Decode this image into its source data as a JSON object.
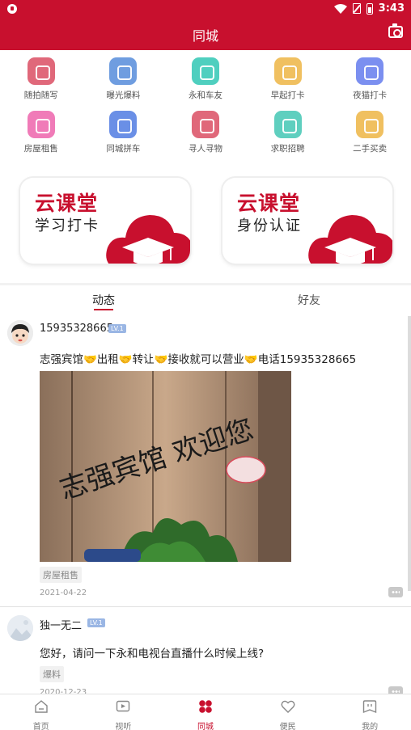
{
  "status_bar": {
    "time": "3:43"
  },
  "header": {
    "title": "同城"
  },
  "quick_actions": [
    {
      "label": "随拍随写",
      "icon": "camera-icon",
      "color": "#e0687a"
    },
    {
      "label": "曝光爆料",
      "icon": "siren-icon",
      "color": "#6f9de0"
    },
    {
      "label": "永和车友",
      "icon": "car-friends-icon",
      "color": "#4fcfbf"
    },
    {
      "label": "早起打卡",
      "icon": "sun-icon",
      "color": "#f0c060"
    },
    {
      "label": "夜猫打卡",
      "icon": "moon-icon",
      "color": "#7b8ff0"
    },
    {
      "label": "房屋租售",
      "icon": "house-icon",
      "color": "#f07bb8"
    },
    {
      "label": "同城拼车",
      "icon": "carpool-icon",
      "color": "#6a8fe6"
    },
    {
      "label": "寻人寻物",
      "icon": "search-person-icon",
      "color": "#e0687a"
    },
    {
      "label": "求职招聘",
      "icon": "job-icon",
      "color": "#5fcfbf"
    },
    {
      "label": "二手买卖",
      "icon": "trade-icon",
      "color": "#f0c060"
    }
  ],
  "banners": [
    {
      "title": "云课堂",
      "subtitle": "学习打卡"
    },
    {
      "title": "云课堂",
      "subtitle": "身份认证"
    }
  ],
  "tabs": [
    {
      "label": "动态",
      "active": true
    },
    {
      "label": "好友",
      "active": false
    }
  ],
  "posts": [
    {
      "username": "15935328665",
      "level": "LV.1",
      "content": "志强宾馆🤝出租🤝转让🤝接收就可以营业🤝电话15935328665",
      "image_text": "志强宾馆 欢迎您",
      "tag": "房屋租售",
      "date": "2021-04-22"
    },
    {
      "username": "独一无二",
      "level": "LV.1",
      "content": "您好，请问一下永和电视台直播什么时候上线?",
      "tag": "爆料",
      "date": "2020-12-23"
    }
  ],
  "bottom_nav": [
    {
      "label": "首页",
      "icon": "home-icon",
      "active": false
    },
    {
      "label": "视听",
      "icon": "video-icon",
      "active": false
    },
    {
      "label": "同城",
      "icon": "city-icon",
      "active": true
    },
    {
      "label": "便民",
      "icon": "heart-icon",
      "active": false
    },
    {
      "label": "我的",
      "icon": "profile-icon",
      "active": false
    }
  ],
  "colors": {
    "brand_red": "#c8102e"
  }
}
